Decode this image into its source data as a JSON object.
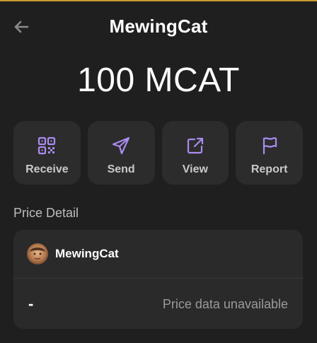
{
  "header": {
    "title": "MewingCat",
    "back_icon": "arrow-left-icon"
  },
  "balance": {
    "text": "100 MCAT"
  },
  "actions": [
    {
      "label": "Receive",
      "icon": "qr-code-icon"
    },
    {
      "label": "Send",
      "icon": "send-icon"
    },
    {
      "label": "View",
      "icon": "external-link-icon"
    },
    {
      "label": "Report",
      "icon": "flag-icon"
    }
  ],
  "price_detail": {
    "section_title": "Price Detail",
    "token_name": "MewingCat",
    "price_value": "-",
    "price_status": "Price data unavailable"
  },
  "colors": {
    "background": "#1f1f1f",
    "card": "#2c2c2c",
    "accent_icon": "#a98cf0",
    "top_accent": "#c99a2e"
  }
}
